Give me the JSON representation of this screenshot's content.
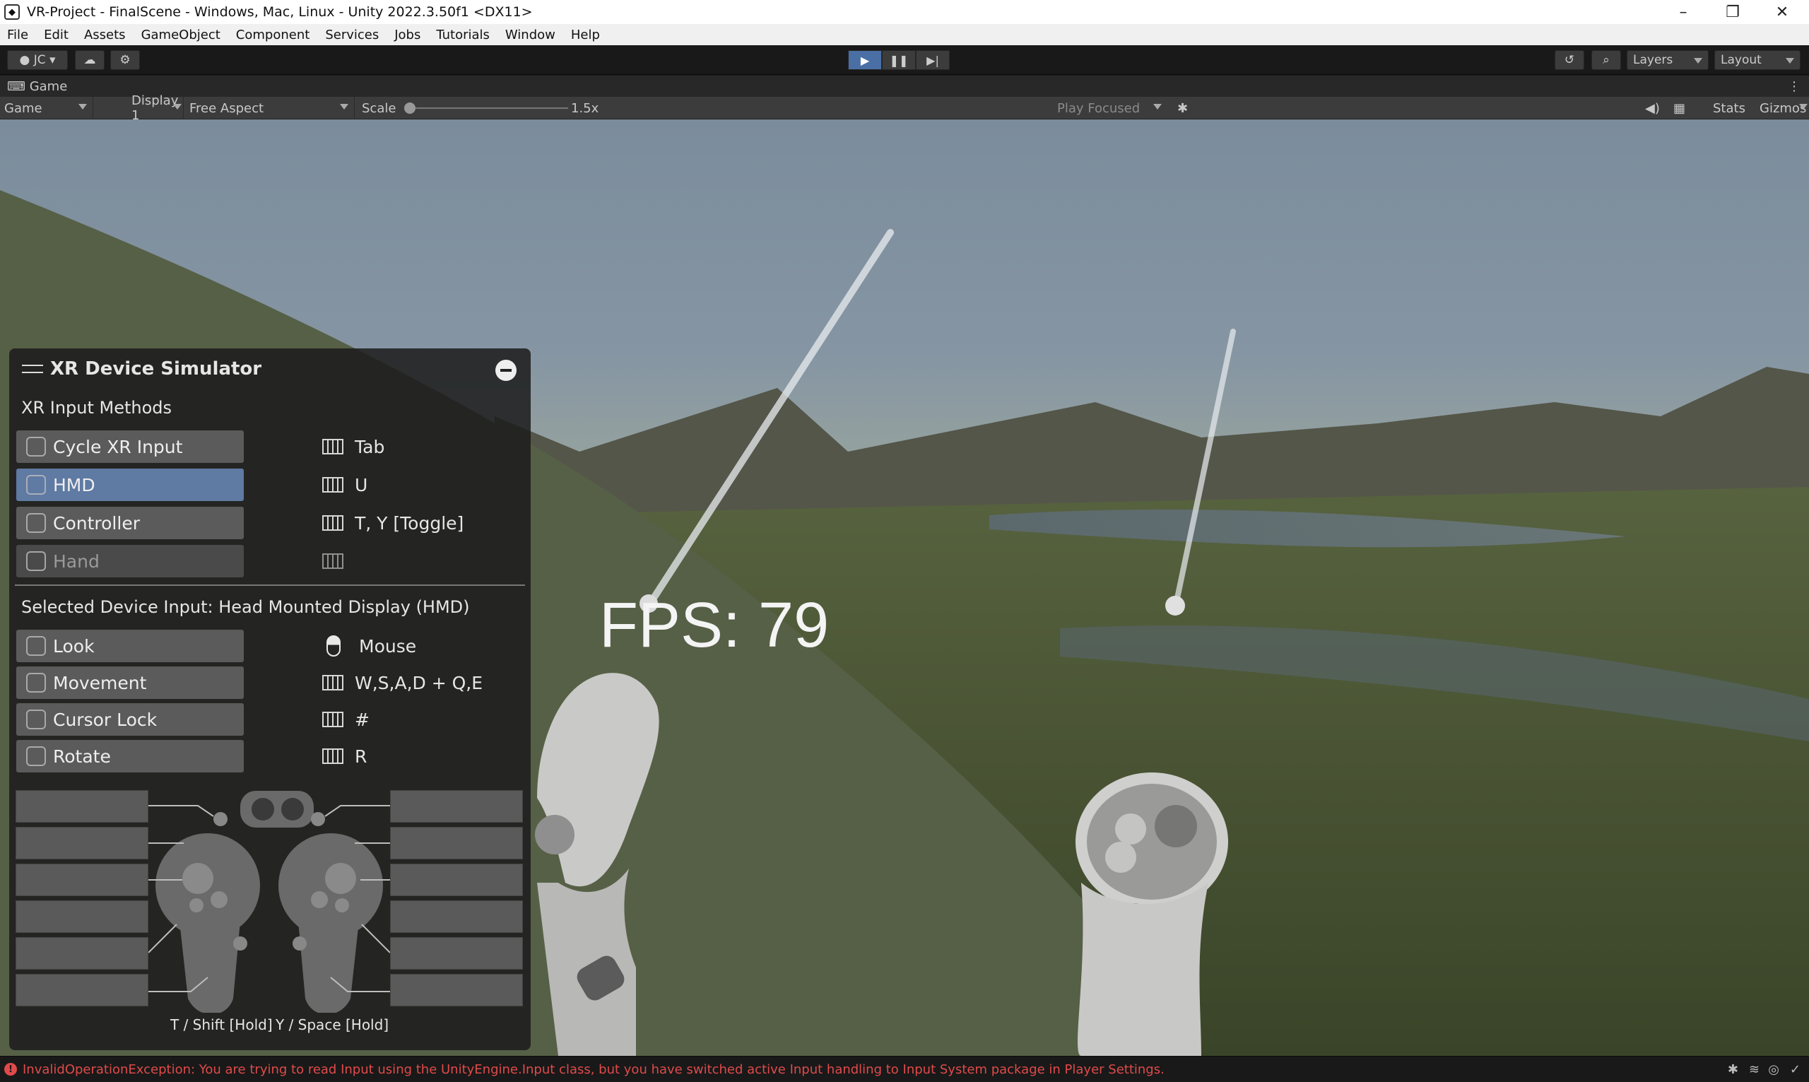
{
  "window": {
    "title": "VR-Project - FinalScene - Windows, Mac, Linux - Unity 2022.3.50f1 <DX11>"
  },
  "menu": [
    "File",
    "Edit",
    "Assets",
    "GameObject",
    "Component",
    "Services",
    "Jobs",
    "Tutorials",
    "Window",
    "Help"
  ],
  "toolbar": {
    "account": "JC",
    "layers": "Layers",
    "layout": "Layout"
  },
  "tab": {
    "label": "Game"
  },
  "game_toolbar": {
    "view": "Game",
    "display": "Display 1",
    "aspect": "Free Aspect",
    "scale_label": "Scale",
    "scale_value": "1.5x",
    "play_mode": "Play Focused",
    "stats": "Stats",
    "gizmos": "Gizmos"
  },
  "fps": "FPS: 79",
  "simulator": {
    "title": "XR Device Simulator",
    "input_methods_title": "XR Input Methods",
    "methods": [
      {
        "label": "Cycle XR Input",
        "key": "Tab"
      },
      {
        "label": "HMD",
        "key": "U"
      },
      {
        "label": "Controller",
        "key": "T, Y [Toggle]"
      },
      {
        "label": "Hand",
        "key": ""
      }
    ],
    "selected_title": "Selected Device Input: Head Mounted Display (HMD)",
    "inputs": [
      {
        "label": "Look",
        "key": "Mouse"
      },
      {
        "label": "Movement",
        "key": "W,S,A,D + Q,E"
      },
      {
        "label": "Cursor Lock",
        "key": "#"
      },
      {
        "label": "Rotate",
        "key": "R"
      }
    ],
    "hold_left": "T / Shift [Hold]",
    "hold_right": "Y / Space [Hold]"
  },
  "status": {
    "error": "InvalidOperationException: You are trying to read Input using the UnityEngine.Input class, but you have switched active Input handling to Input System package in Player Settings."
  }
}
